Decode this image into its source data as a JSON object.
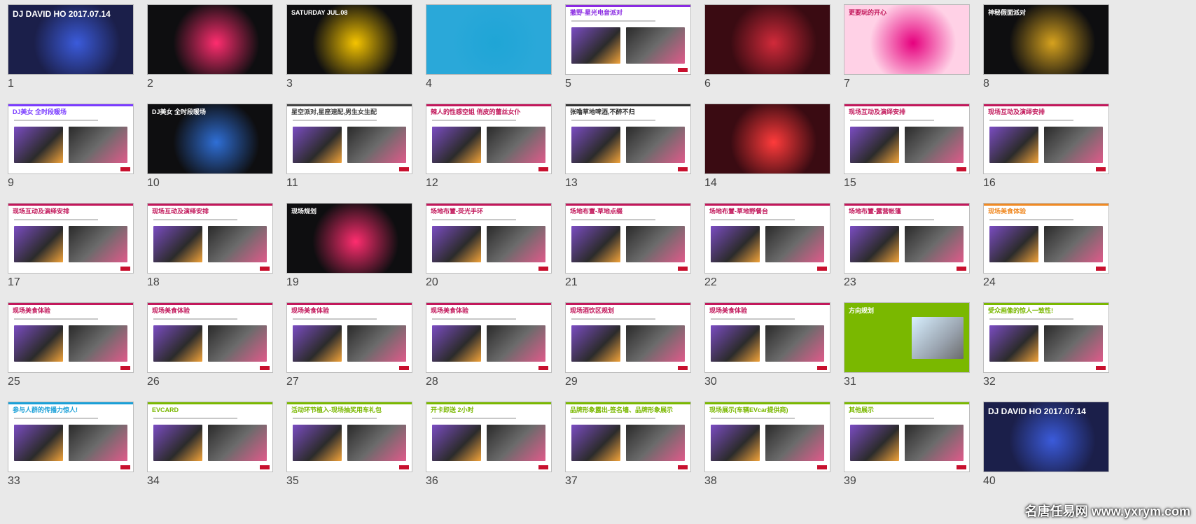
{
  "slides": [
    {
      "num": "1",
      "caption": "DJ DAVID HO 2017.07.14",
      "theme": "dark-blue",
      "accent": "#3b5bdb"
    },
    {
      "num": "2",
      "caption": "",
      "theme": "dark",
      "accent": "#ff2d6f"
    },
    {
      "num": "3",
      "caption": "SATURDAY JUL.08",
      "theme": "dark",
      "accent": "#f5c400"
    },
    {
      "num": "4",
      "caption": "",
      "theme": "sea",
      "accent": "#1fa5d6"
    },
    {
      "num": "5",
      "caption": "撒野-星光电音派对",
      "theme": "white",
      "accent": "#8a2be2"
    },
    {
      "num": "6",
      "caption": "",
      "theme": "stage",
      "accent": "#d12a3a"
    },
    {
      "num": "7",
      "caption": "更要玩的开心",
      "theme": "pink",
      "accent": "#e6007e"
    },
    {
      "num": "8",
      "caption": "神秘假面派对",
      "theme": "dark",
      "accent": "#d6a21e"
    },
    {
      "num": "9",
      "caption": "DJ美女 全时段暖场",
      "theme": "white",
      "accent": "#7a3cff"
    },
    {
      "num": "10",
      "caption": "DJ美女 全时段暖场",
      "theme": "dark",
      "accent": "#2f6fd6"
    },
    {
      "num": "11",
      "caption": "星空派对,星座速配,男生女生配",
      "theme": "white",
      "accent": "#444444"
    },
    {
      "num": "12",
      "caption": "辣人的性感空姐 俏皮的蕾丝女仆",
      "theme": "white",
      "accent": "#c2185b"
    },
    {
      "num": "13",
      "caption": "张噜草地啤酒,不醉不归",
      "theme": "white",
      "accent": "#333333"
    },
    {
      "num": "14",
      "caption": "",
      "theme": "stage",
      "accent": "#ff3b3b"
    },
    {
      "num": "15",
      "caption": "现场互动及演绎安排",
      "theme": "white",
      "accent": "#c2185b"
    },
    {
      "num": "16",
      "caption": "现场互动及演绎安排",
      "theme": "white",
      "accent": "#c2185b"
    },
    {
      "num": "17",
      "caption": "现场互动及演绎安排",
      "theme": "white",
      "accent": "#c2185b"
    },
    {
      "num": "18",
      "caption": "现场互动及演绎安排",
      "theme": "white",
      "accent": "#c2185b"
    },
    {
      "num": "19",
      "caption": "现场规划",
      "theme": "dark",
      "accent": "#ff2d6f"
    },
    {
      "num": "20",
      "caption": "场地布置-荧光手环",
      "theme": "white",
      "accent": "#c2185b"
    },
    {
      "num": "21",
      "caption": "场地布置-草地点缀",
      "theme": "white",
      "accent": "#c2185b"
    },
    {
      "num": "22",
      "caption": "场地布置-草地野餐台",
      "theme": "white",
      "accent": "#c2185b"
    },
    {
      "num": "23",
      "caption": "场地布置-露营帐篷",
      "theme": "white",
      "accent": "#c2185b"
    },
    {
      "num": "24",
      "caption": "现场美食体验",
      "theme": "white",
      "accent": "#f08a24"
    },
    {
      "num": "25",
      "caption": "现场美食体验",
      "theme": "white",
      "accent": "#c2185b"
    },
    {
      "num": "26",
      "caption": "现场美食体验",
      "theme": "white",
      "accent": "#c2185b"
    },
    {
      "num": "27",
      "caption": "现场美食体验",
      "theme": "white",
      "accent": "#c2185b"
    },
    {
      "num": "28",
      "caption": "现场美食体验",
      "theme": "white",
      "accent": "#c2185b"
    },
    {
      "num": "29",
      "caption": "现场酒饮区规划",
      "theme": "white",
      "accent": "#c2185b"
    },
    {
      "num": "30",
      "caption": "现场美食体验",
      "theme": "white",
      "accent": "#c2185b"
    },
    {
      "num": "31",
      "caption": "方向规划",
      "theme": "green",
      "accent": "#7ab800"
    },
    {
      "num": "32",
      "caption": "受众画像的惊人一致性!",
      "theme": "white",
      "accent": "#7ab800"
    },
    {
      "num": "33",
      "caption": "参与人群的传播力惊人!",
      "theme": "white",
      "accent": "#1aa0d8"
    },
    {
      "num": "34",
      "caption": "EVCARD",
      "theme": "white",
      "accent": "#7ab800"
    },
    {
      "num": "35",
      "caption": "活动环节植入-现场抽奖用车礼包",
      "theme": "white",
      "accent": "#7ab800"
    },
    {
      "num": "36",
      "caption": "开卡即送 2小时",
      "theme": "white",
      "accent": "#7ab800"
    },
    {
      "num": "37",
      "caption": "品牌形象露出-签名墙、品牌形象展示",
      "theme": "white",
      "accent": "#7ab800"
    },
    {
      "num": "38",
      "caption": "现场展示(车辆EVcar提供商)",
      "theme": "white",
      "accent": "#7ab800"
    },
    {
      "num": "39",
      "caption": "其他展示",
      "theme": "white",
      "accent": "#7ab800"
    },
    {
      "num": "40",
      "caption": "DJ DAVID HO 2017.07.14",
      "theme": "dark-blue",
      "accent": "#3b5bdb"
    }
  ],
  "watermark": "名唐任易网 www.yxrym.com"
}
